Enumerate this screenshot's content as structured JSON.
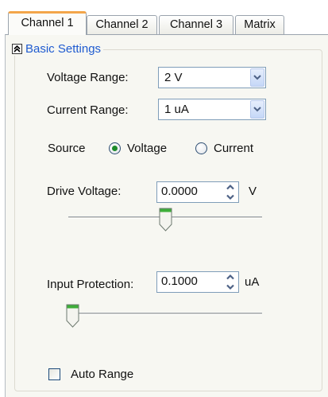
{
  "tabs": [
    {
      "label": "Channel 1",
      "active": true
    },
    {
      "label": "Channel 2",
      "active": false
    },
    {
      "label": "Channel 3",
      "active": false
    },
    {
      "label": "Matrix",
      "active": false
    }
  ],
  "group": {
    "title": "Basic Settings",
    "collapse_icon": "double-chevron-up-icon"
  },
  "voltage_range": {
    "label": "Voltage Range:",
    "value": "2 V"
  },
  "current_range": {
    "label": "Current Range:",
    "value": "1 uA"
  },
  "source": {
    "label": "Source",
    "options": [
      {
        "label": "Voltage",
        "checked": true
      },
      {
        "label": "Current",
        "checked": false
      }
    ]
  },
  "drive_voltage": {
    "label": "Drive Voltage:",
    "value": "0.0000",
    "unit": "V",
    "slider_fraction": 0.5
  },
  "input_protection": {
    "label": "Input Protection:",
    "value": "0.1000",
    "unit": "uA",
    "slider_fraction": 0.0
  },
  "auto_range": {
    "label": "Auto Range",
    "checked": false
  },
  "colors": {
    "accent_tab": "#f3a54a",
    "group_title": "#1f5bd0",
    "radio_dot": "#1c8a2a",
    "slider_thumb_top": "#3fae3a"
  }
}
